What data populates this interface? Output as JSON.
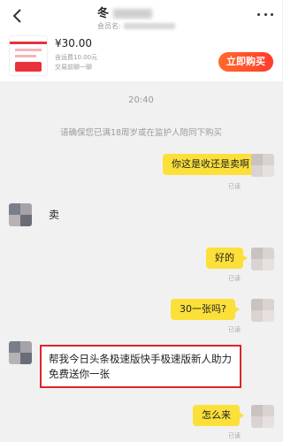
{
  "header": {
    "title": "冬",
    "seller_label": "会员名:"
  },
  "product": {
    "price": "¥30.00",
    "shipping": "含运费10.00元",
    "deal_status": "交易前聊一聊",
    "buy_label": "立即购买"
  },
  "chat": {
    "timestamp": "20:40",
    "notice": "请确保您已满18周岁或在监护人陪同下购买",
    "messages": [
      {
        "from": "me",
        "text": "你这是收还是卖啊",
        "status": "已读"
      },
      {
        "from": "them",
        "text": "卖"
      },
      {
        "from": "me",
        "text": "好的",
        "status": "已读"
      },
      {
        "from": "me",
        "text": "30一张吗?",
        "status": "已读"
      },
      {
        "from": "them",
        "text": "帮我今日头条极速版快手极速版新人助力免费送你一张",
        "highlighted": true
      },
      {
        "from": "me",
        "text": "怎么来",
        "status": "已读"
      }
    ]
  },
  "icons": {
    "back": "chevron-left-icon",
    "more": "more-dots-icon"
  },
  "colors": {
    "my_bubble": "#fce03a",
    "buy_button": "#ff4a2d",
    "highlight_border": "#d9262b"
  }
}
